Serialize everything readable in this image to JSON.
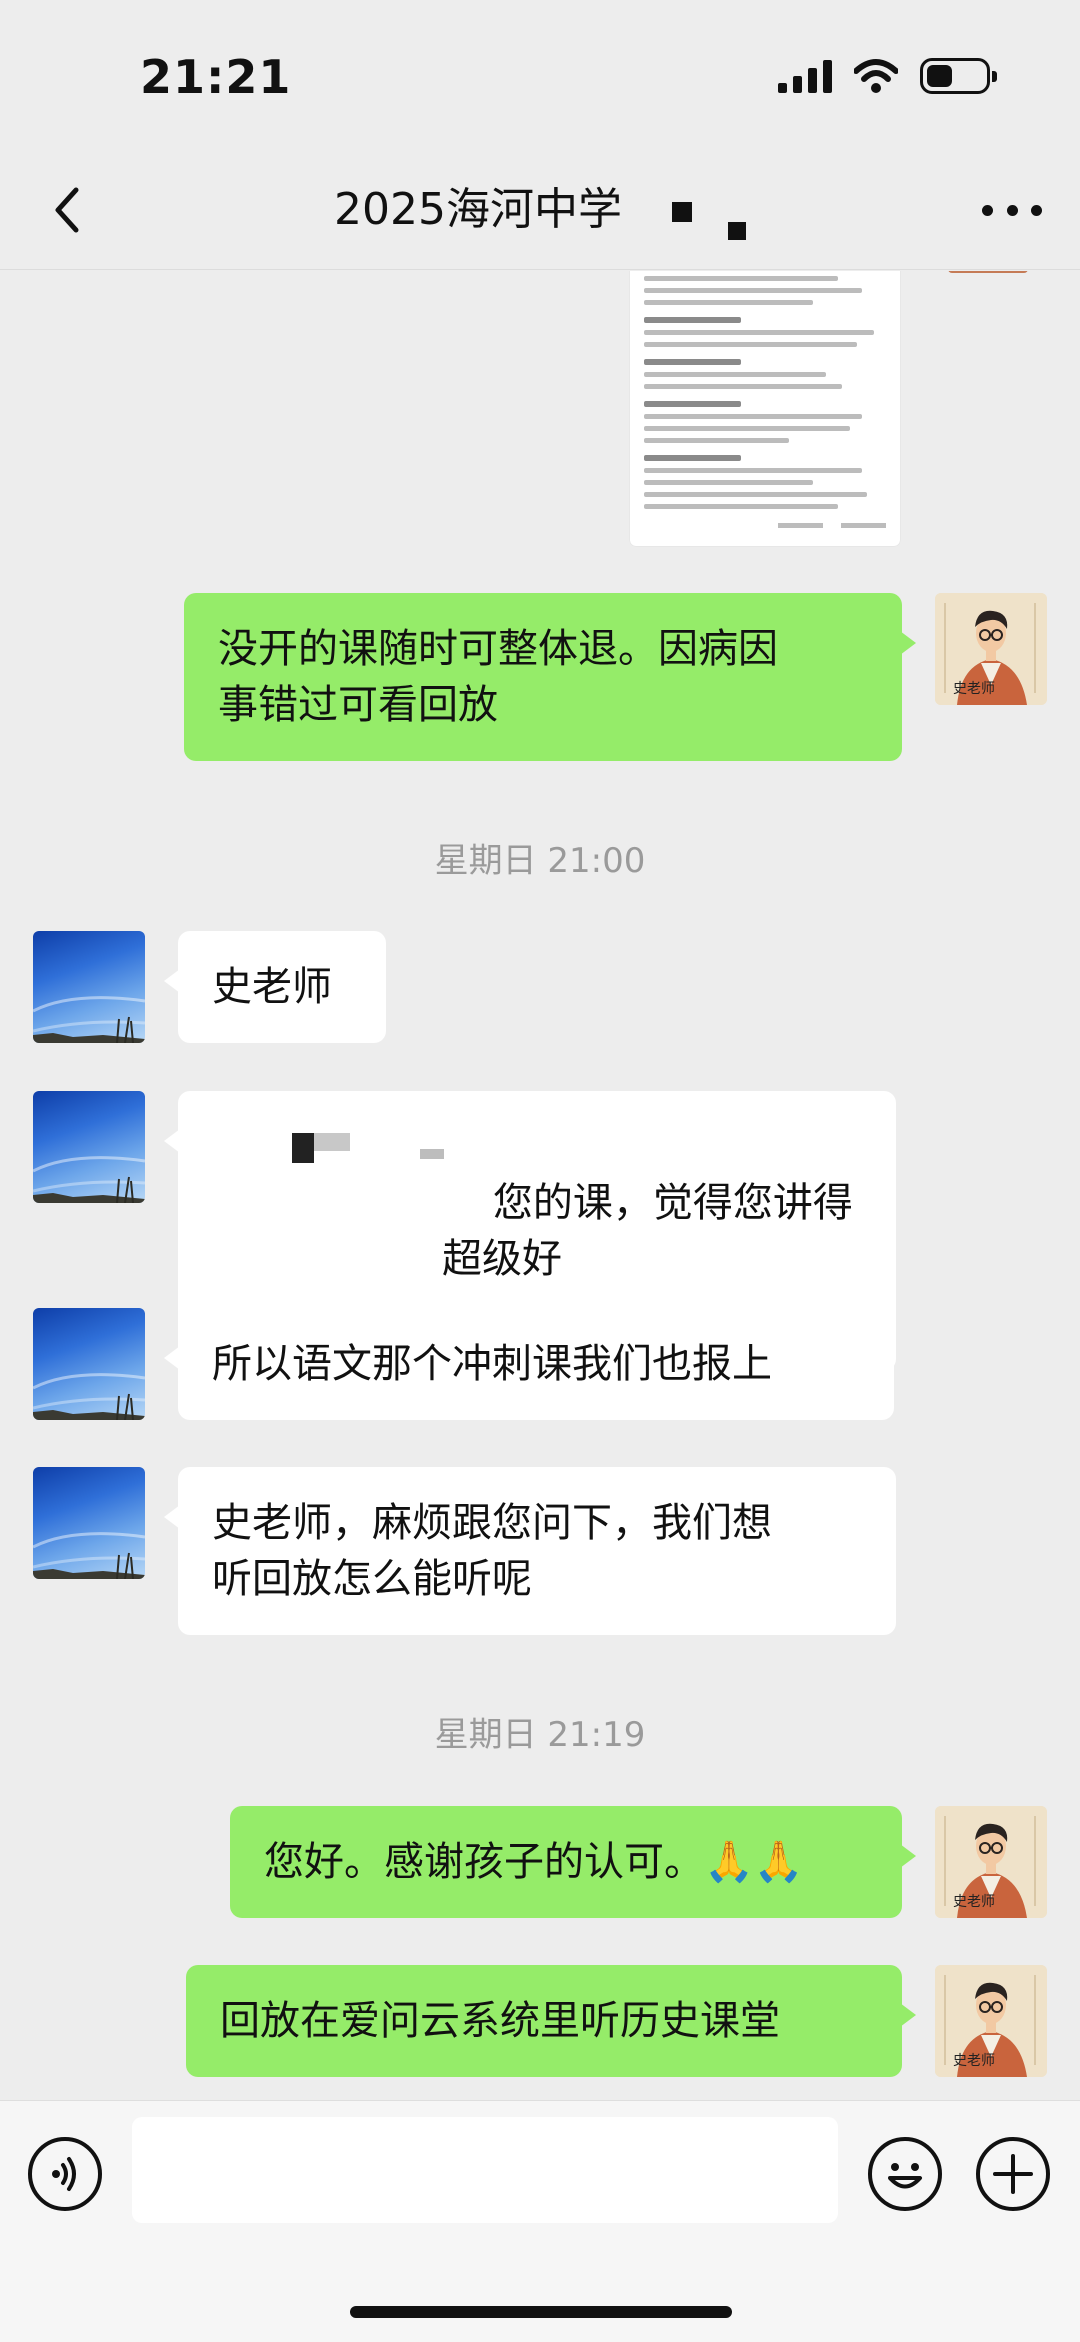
{
  "status_bar": {
    "time": "21:21",
    "icons": [
      "signal-icon",
      "wifi-icon",
      "battery-icon"
    ]
  },
  "nav": {
    "title": "2025海河中学",
    "back_icon": "chevron-left-icon",
    "more_icon": "more-dots-icon"
  },
  "messages": [
    {
      "side": "out",
      "text": "没开的课随时可整体退。因病因\n事错过可看回放",
      "avatar": "teacher-avatar"
    },
    {
      "timestamp": "星期日 21:00"
    },
    {
      "side": "in",
      "text": "史老师",
      "avatar": "sky-avatar"
    },
    {
      "side": "in",
      "text": "您的课，觉得您讲得\n超级好",
      "avatar": "sky-avatar",
      "partially_redacted": true
    },
    {
      "side": "in",
      "text": "所以语文那个冲刺课我们也报上",
      "avatar": "sky-avatar"
    },
    {
      "side": "in",
      "text": "史老师，麻烦跟您问下，我们想\n听回放怎么能听呢",
      "avatar": "sky-avatar"
    },
    {
      "timestamp": "星期日 21:19"
    },
    {
      "side": "out",
      "text": "您好。感谢孩子的认可。🙏🙏",
      "avatar": "teacher-avatar"
    },
    {
      "side": "out",
      "text": "回放在爱问云系统里听历史课堂",
      "avatar": "teacher-avatar"
    }
  ],
  "input_bar": {
    "value": "",
    "icons": [
      "voice-icon",
      "emoji-icon",
      "plus-icon"
    ]
  },
  "colors": {
    "background": "#ededed",
    "outgoing_bubble": "#95ec69",
    "incoming_bubble": "#ffffff",
    "timestamp_text": "#9a9a9a"
  }
}
